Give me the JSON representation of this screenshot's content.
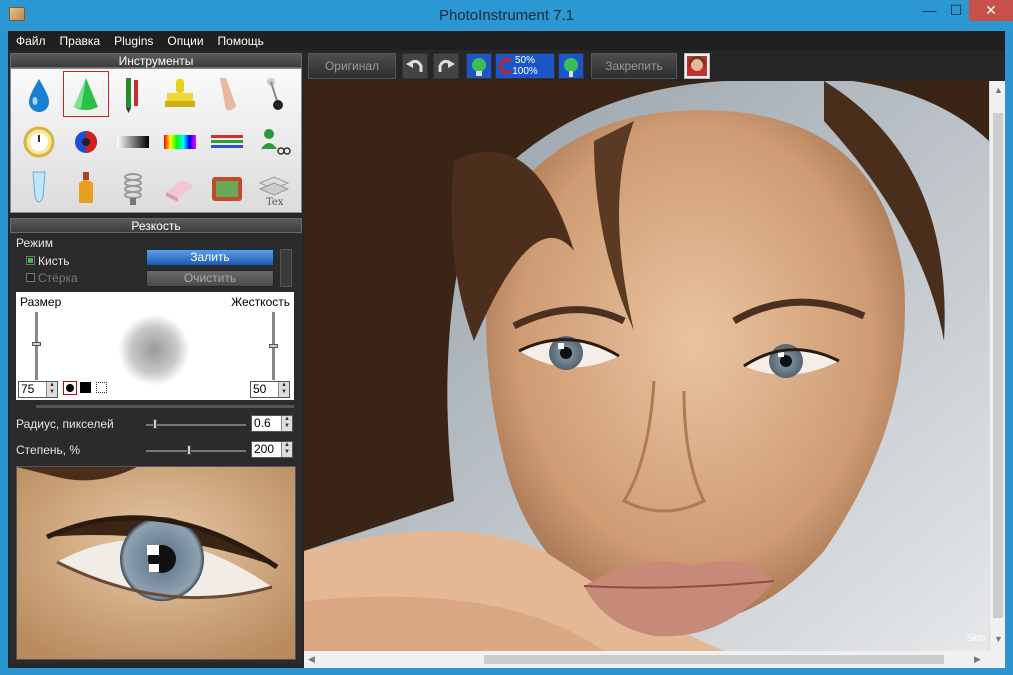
{
  "window": {
    "title": "PhotoInstrument 7.1",
    "min": "—",
    "max": "☐",
    "close": "✕"
  },
  "menu": [
    "Файл",
    "Правка",
    "Plugins",
    "Опции",
    "Помощь"
  ],
  "tools_panel": {
    "title": "Инструменты"
  },
  "tool_icons": [
    "water-drop-icon",
    "cone-icon",
    "pencil-brush-icon",
    "stamp-icon",
    "finger-icon",
    "pin-icon",
    "clock-icon",
    "color-circle-icon",
    "gradient-icon",
    "rainbow-icon",
    "color-lines-icon",
    "user-scissors-icon",
    "test-tube-icon",
    "bottle-icon",
    "spring-icon",
    "eraser-icon",
    "tv-icon",
    "text-layers-icon"
  ],
  "settings_panel": {
    "title": "Резкость",
    "mode_label": "Режим",
    "brush_label": "Кисть",
    "eraser_label": "Стёрка",
    "fill_button": "Залить",
    "clear_button": "Очистить",
    "size_label": "Размер",
    "hardness_label": "Жесткость",
    "size_value": "75",
    "hardness_value": "50",
    "radius_label": "Радиус, пикселей",
    "radius_value": "0.6",
    "degree_label": "Степень, %",
    "degree_value": "200"
  },
  "toolbar": {
    "original_button": "Оригинал",
    "zoom_top": "50%",
    "zoom_bottom": "100%",
    "pin_button": "Закрепить"
  },
  "canvas": {
    "watermark": "Skin"
  },
  "colors": {
    "accent_blue": "#2b97d3",
    "close_red": "#c7504a",
    "fill_button": "#1f5ab0",
    "brush_check": "#3cc03c"
  }
}
